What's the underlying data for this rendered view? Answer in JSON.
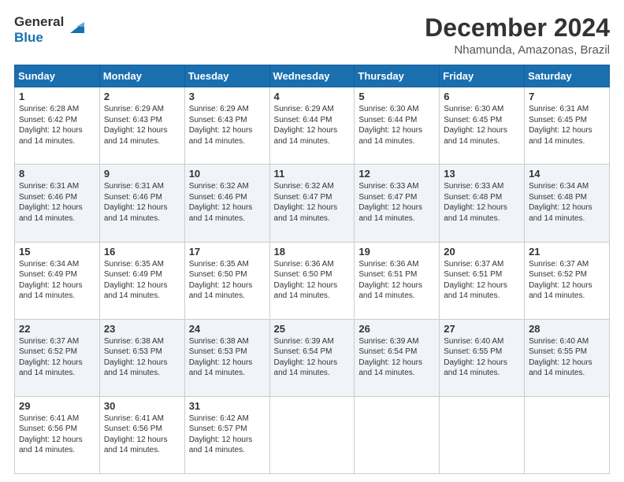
{
  "logo": {
    "line1": "General",
    "line2": "Blue"
  },
  "title": "December 2024",
  "subtitle": "Nhamunda, Amazonas, Brazil",
  "days_header": [
    "Sunday",
    "Monday",
    "Tuesday",
    "Wednesday",
    "Thursday",
    "Friday",
    "Saturday"
  ],
  "weeks": [
    [
      {
        "day": "1",
        "sunrise": "6:28 AM",
        "sunset": "6:42 PM",
        "daylight": "12 hours and 14 minutes."
      },
      {
        "day": "2",
        "sunrise": "6:29 AM",
        "sunset": "6:43 PM",
        "daylight": "12 hours and 14 minutes."
      },
      {
        "day": "3",
        "sunrise": "6:29 AM",
        "sunset": "6:43 PM",
        "daylight": "12 hours and 14 minutes."
      },
      {
        "day": "4",
        "sunrise": "6:29 AM",
        "sunset": "6:44 PM",
        "daylight": "12 hours and 14 minutes."
      },
      {
        "day": "5",
        "sunrise": "6:30 AM",
        "sunset": "6:44 PM",
        "daylight": "12 hours and 14 minutes."
      },
      {
        "day": "6",
        "sunrise": "6:30 AM",
        "sunset": "6:45 PM",
        "daylight": "12 hours and 14 minutes."
      },
      {
        "day": "7",
        "sunrise": "6:31 AM",
        "sunset": "6:45 PM",
        "daylight": "12 hours and 14 minutes."
      }
    ],
    [
      {
        "day": "8",
        "sunrise": "6:31 AM",
        "sunset": "6:46 PM",
        "daylight": "12 hours and 14 minutes."
      },
      {
        "day": "9",
        "sunrise": "6:31 AM",
        "sunset": "6:46 PM",
        "daylight": "12 hours and 14 minutes."
      },
      {
        "day": "10",
        "sunrise": "6:32 AM",
        "sunset": "6:46 PM",
        "daylight": "12 hours and 14 minutes."
      },
      {
        "day": "11",
        "sunrise": "6:32 AM",
        "sunset": "6:47 PM",
        "daylight": "12 hours and 14 minutes."
      },
      {
        "day": "12",
        "sunrise": "6:33 AM",
        "sunset": "6:47 PM",
        "daylight": "12 hours and 14 minutes."
      },
      {
        "day": "13",
        "sunrise": "6:33 AM",
        "sunset": "6:48 PM",
        "daylight": "12 hours and 14 minutes."
      },
      {
        "day": "14",
        "sunrise": "6:34 AM",
        "sunset": "6:48 PM",
        "daylight": "12 hours and 14 minutes."
      }
    ],
    [
      {
        "day": "15",
        "sunrise": "6:34 AM",
        "sunset": "6:49 PM",
        "daylight": "12 hours and 14 minutes."
      },
      {
        "day": "16",
        "sunrise": "6:35 AM",
        "sunset": "6:49 PM",
        "daylight": "12 hours and 14 minutes."
      },
      {
        "day": "17",
        "sunrise": "6:35 AM",
        "sunset": "6:50 PM",
        "daylight": "12 hours and 14 minutes."
      },
      {
        "day": "18",
        "sunrise": "6:36 AM",
        "sunset": "6:50 PM",
        "daylight": "12 hours and 14 minutes."
      },
      {
        "day": "19",
        "sunrise": "6:36 AM",
        "sunset": "6:51 PM",
        "daylight": "12 hours and 14 minutes."
      },
      {
        "day": "20",
        "sunrise": "6:37 AM",
        "sunset": "6:51 PM",
        "daylight": "12 hours and 14 minutes."
      },
      {
        "day": "21",
        "sunrise": "6:37 AM",
        "sunset": "6:52 PM",
        "daylight": "12 hours and 14 minutes."
      }
    ],
    [
      {
        "day": "22",
        "sunrise": "6:37 AM",
        "sunset": "6:52 PM",
        "daylight": "12 hours and 14 minutes."
      },
      {
        "day": "23",
        "sunrise": "6:38 AM",
        "sunset": "6:53 PM",
        "daylight": "12 hours and 14 minutes."
      },
      {
        "day": "24",
        "sunrise": "6:38 AM",
        "sunset": "6:53 PM",
        "daylight": "12 hours and 14 minutes."
      },
      {
        "day": "25",
        "sunrise": "6:39 AM",
        "sunset": "6:54 PM",
        "daylight": "12 hours and 14 minutes."
      },
      {
        "day": "26",
        "sunrise": "6:39 AM",
        "sunset": "6:54 PM",
        "daylight": "12 hours and 14 minutes."
      },
      {
        "day": "27",
        "sunrise": "6:40 AM",
        "sunset": "6:55 PM",
        "daylight": "12 hours and 14 minutes."
      },
      {
        "day": "28",
        "sunrise": "6:40 AM",
        "sunset": "6:55 PM",
        "daylight": "12 hours and 14 minutes."
      }
    ],
    [
      {
        "day": "29",
        "sunrise": "6:41 AM",
        "sunset": "6:56 PM",
        "daylight": "12 hours and 14 minutes."
      },
      {
        "day": "30",
        "sunrise": "6:41 AM",
        "sunset": "6:56 PM",
        "daylight": "12 hours and 14 minutes."
      },
      {
        "day": "31",
        "sunrise": "6:42 AM",
        "sunset": "6:57 PM",
        "daylight": "12 hours and 14 minutes."
      },
      null,
      null,
      null,
      null
    ]
  ],
  "daylight_label": "Daylight:",
  "sunrise_label": "Sunrise:",
  "sunset_label": "Sunset:"
}
